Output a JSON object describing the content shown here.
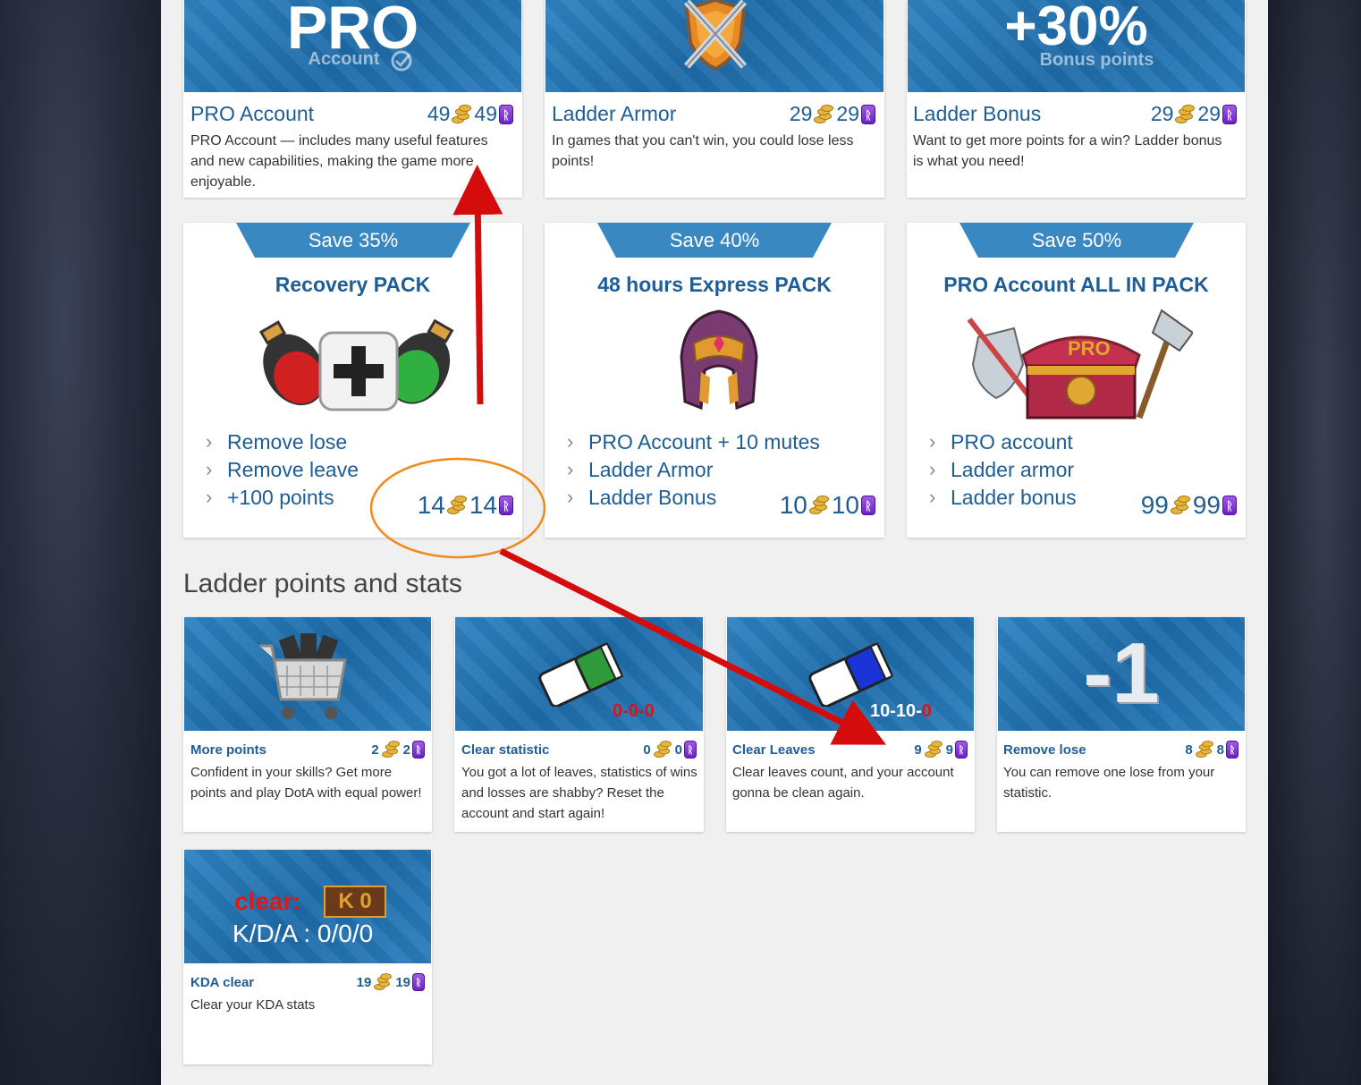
{
  "top_cards": [
    {
      "banner_main": "PRO",
      "banner_sub": "Account",
      "name": "PRO Account",
      "gold": "49",
      "runes": "49",
      "desc": "PRO Account — includes many useful features and new capabilities, making the game more enjoyable."
    },
    {
      "banner_main": "",
      "banner_sub": "",
      "name": "Ladder Armor",
      "gold": "29",
      "runes": "29",
      "desc": "In games that you can't win, you could lose less points!"
    },
    {
      "banner_main": "+30%",
      "banner_sub": "Bonus points",
      "name": "Ladder Bonus",
      "gold": "29",
      "runes": "29",
      "desc": "Want to get more points for a win? Ladder bonus is what you need!"
    }
  ],
  "packs": [
    {
      "ribbon": "Save 35%",
      "title": "Recovery PACK",
      "items": [
        "Remove lose",
        "Remove leave",
        "+100 points"
      ],
      "gold": "14",
      "runes": "14"
    },
    {
      "ribbon": "Save 40%",
      "title": "48 hours Express PACK",
      "items": [
        "PRO Account + 10 mutes",
        "Ladder Armor",
        "Ladder Bonus"
      ],
      "gold": "10",
      "runes": "10"
    },
    {
      "ribbon": "Save 50%",
      "title": "PRO Account ALL IN PACK",
      "items": [
        "PRO account",
        "Ladder armor",
        "Ladder bonus"
      ],
      "gold": "99",
      "runes": "99"
    }
  ],
  "section_title": "Ladder points and stats",
  "stat_cards": [
    {
      "name": "More points",
      "gold": "2",
      "runes": "2",
      "desc": "Confident in your skills? Get more points and play DotA with equal power!",
      "banner_text": ""
    },
    {
      "name": "Clear statistic",
      "gold": "0",
      "runes": "0",
      "desc": "You got a lot of leaves, statistics of wins and losses are shabby? Reset the account and start again!",
      "banner_text": "0-0-0"
    },
    {
      "name": "Clear Leaves",
      "gold": "9",
      "runes": "9",
      "desc": "Clear leaves count, and your account gonna be clean again.",
      "banner_text": "10-10-0"
    },
    {
      "name": "Remove lose",
      "gold": "8",
      "runes": "8",
      "desc": "You can remove one lose from your statistic.",
      "banner_text": "-1"
    },
    {
      "name": "KDA clear",
      "gold": "19",
      "runes": "19",
      "desc": "Clear your KDA stats",
      "banner_text": "K/D/A : 0/0/0",
      "banner_clear": "clear:",
      "banner_k": "K 0"
    }
  ],
  "rune_glyph": "ᚱ",
  "colors": {
    "accent": "#1e5d96",
    "banner": "#2a7dbc",
    "ribbon": "#3a88c2",
    "arrow": "#d40c0c",
    "circle": "#f08a1c",
    "rune": "#8a3ee0",
    "gold": "#e6b53a"
  },
  "icons": [
    "shield-swords-icon",
    "potions-plus-icon",
    "helmet-icon",
    "chest-weapons-icon",
    "cart-icon",
    "eraser-green-icon",
    "eraser-blue-icon"
  ]
}
